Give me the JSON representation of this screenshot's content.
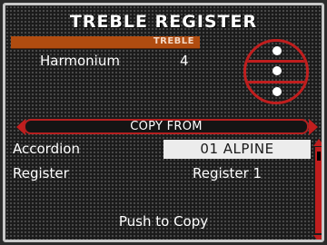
{
  "title": "TREBLE REGISTER",
  "section_tag": "TREBLE",
  "current_register": {
    "name": "Harmonium",
    "number": "4"
  },
  "register_symbol": {
    "icon": "treble-register-three-dots-icon",
    "dots": 3
  },
  "copy_from": {
    "label": "COPY FROM",
    "accordion_label": "Accordion",
    "accordion_value": "01 ALPINE",
    "register_label": "Register",
    "register_value": "Register 1"
  },
  "action_text": "Push to Copy",
  "colors": {
    "accent": "#c01e1e",
    "tag_bar": "#b04c10",
    "highlight": "#ececec"
  }
}
